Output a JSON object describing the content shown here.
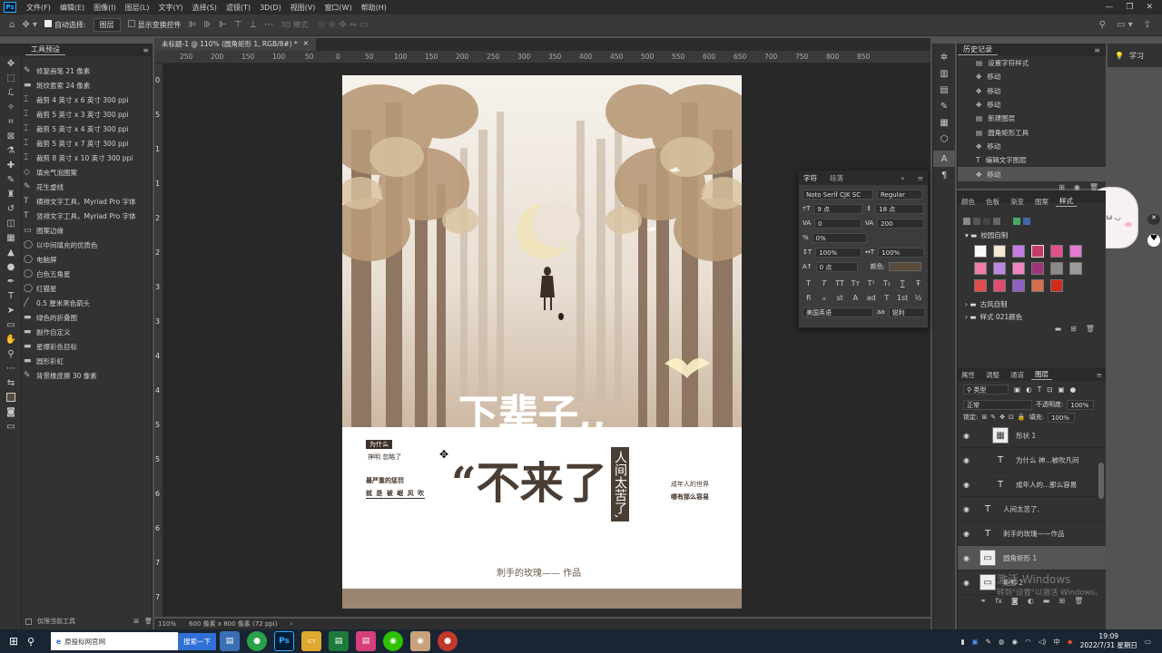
{
  "app": {
    "logo": "Ps"
  },
  "menu": [
    "文件(F)",
    "编辑(E)",
    "图像(I)",
    "图层(L)",
    "文字(Y)",
    "选择(S)",
    "滤镜(T)",
    "3D(D)",
    "视图(V)",
    "窗口(W)",
    "帮助(H)"
  ],
  "options": {
    "auto_select_label": "自动选择:",
    "auto_select_value": "图层",
    "show_transform_label": "显示变换控件",
    "mode3d_label": "3D 模式:"
  },
  "doc_tab": {
    "title": "未标题-1 @ 110% (圆角矩形 1, RGB/8#) *",
    "close": "×"
  },
  "ruler_h": [
    "250",
    "200",
    "150",
    "100",
    "50",
    "0",
    "50",
    "100",
    "150",
    "200",
    "250",
    "300",
    "350",
    "400",
    "450",
    "500",
    "550",
    "600",
    "650",
    "700",
    "750",
    "800",
    "850"
  ],
  "ruler_v": [
    "0",
    "5",
    "1",
    "1",
    "2",
    "2",
    "3",
    "3",
    "4",
    "4",
    "5",
    "5",
    "6",
    "6",
    "7",
    "7"
  ],
  "tool_presets_tab": "工具预设",
  "tool_presets": [
    {
      "icon": "✎",
      "label": "修复画笔 21 像素"
    },
    {
      "icon": "▬",
      "label": "斑纹套索 24 像素"
    },
    {
      "icon": "⌶",
      "label": "裁剪 4 英寸 x 6 英寸 300 ppi"
    },
    {
      "icon": "⌶",
      "label": "裁剪 5 英寸 x 3 英寸 300 ppi"
    },
    {
      "icon": "⌶",
      "label": "裁剪 5 英寸 x 4 英寸 300 ppi"
    },
    {
      "icon": "⌶",
      "label": "裁剪 5 英寸 x 7 英寸 300 ppi"
    },
    {
      "icon": "⌶",
      "label": "裁剪 8 英寸 x 10 英寸 300 ppi"
    },
    {
      "icon": "◇",
      "label": "填充气泡图案"
    },
    {
      "icon": "✎",
      "label": "花生虚线"
    },
    {
      "icon": "T",
      "label": "横排文字工具，Myriad Pro 字体"
    },
    {
      "icon": "T",
      "label": "竖排文字工具，Myriad Pro 字体"
    },
    {
      "icon": "▭",
      "label": "图案边缘"
    },
    {
      "icon": "◯",
      "label": "以中间填充的优质色"
    },
    {
      "icon": "◯",
      "label": "电脑屏"
    },
    {
      "icon": "◯",
      "label": "白色五角星"
    },
    {
      "icon": "◯",
      "label": "红猫星"
    },
    {
      "icon": "╱",
      "label": "0.5 厘米黑色箭头"
    },
    {
      "icon": "▬",
      "label": "绿色的折叠图"
    },
    {
      "icon": "▬",
      "label": "副作自定义"
    },
    {
      "icon": "▬",
      "label": "星爆彩色目标"
    },
    {
      "icon": "▬",
      "label": "圆形彩虹"
    },
    {
      "icon": "✎",
      "label": "背景橡皮擦 30 像素"
    }
  ],
  "tool_footer": "仅限当前工具",
  "status": {
    "zoom": "110%",
    "doc_size": "600 像素 x 800 像素 (72 ppi)"
  },
  "poster": {
    "tag": "为什么",
    "line1": "神明 忽略了",
    "line2": "最严重的惩罚",
    "line3": "就 是 被 岷 风 吹",
    "title1": "下辈子,,",
    "title2": "“不来了",
    "vertical": "人间太苦了,",
    "right1": "成年人的世界",
    "right2": "哪有那么容易",
    "credit": "刺手的玫瑰—— 作品"
  },
  "history": {
    "tab": "历史记录",
    "items": [
      {
        "icon": "▤",
        "label": "设置字符样式"
      },
      {
        "icon": "✥",
        "label": "移动"
      },
      {
        "icon": "✥",
        "label": "移动"
      },
      {
        "icon": "✥",
        "label": "移动"
      },
      {
        "icon": "▤",
        "label": "新建图层"
      },
      {
        "icon": "▤",
        "label": "圆角矩形工具"
      },
      {
        "icon": "✥",
        "label": "移动"
      },
      {
        "icon": "T",
        "label": "编辑文字图层"
      },
      {
        "icon": "✥",
        "label": "移动"
      }
    ]
  },
  "learn": {
    "label": "学习"
  },
  "character": {
    "tabs": [
      "字符",
      "段落"
    ],
    "font": "Noto Serif CJK SC",
    "style": "Regular",
    "size": "9 点",
    "leading": "18 点",
    "kerning": "0",
    "tracking": "200",
    "tsume": "0%",
    "vscale": "100%",
    "hscale": "100%",
    "baseline": "0 点",
    "color_label": "颜色:",
    "lang": "美国英语",
    "aa": "锐利",
    "aa_prefix": "aa",
    "style_buttons": [
      "T",
      "T",
      "TT",
      "Tт",
      "T¹",
      "T₁",
      "T",
      "Ŧ"
    ],
    "ot_buttons": [
      "fi",
      "ℴ",
      "st",
      "A",
      "ad",
      "T",
      "1st",
      "½"
    ]
  },
  "swatches": {
    "tabs": [
      "颜色",
      "色板",
      "渐变",
      "图案",
      "样式"
    ],
    "group1": "校园自制",
    "group2": "古风自制",
    "group3": "样式 021颜色",
    "colors": [
      "#f8f8f8",
      "#f3e9d2",
      "#c47adf",
      "#c43b6b",
      "#e24f8c",
      "#e37ad1",
      "#f07ca8",
      "#b78ae0",
      "#ef85c0",
      "#a0337a",
      "#8a8a8a",
      "#9a9a9a",
      "#e24c4c",
      "#e24c6e",
      "#8e62c5",
      "#d86f4a",
      "#d02a1a"
    ]
  },
  "layers": {
    "tabs": [
      "属性",
      "调整",
      "通道",
      "图层"
    ],
    "kind": "类型",
    "blend": "正常",
    "opacity_label": "不透明度:",
    "opacity": "100%",
    "lock_label": "锁定:",
    "fill_label": "填充:",
    "fill": "100%",
    "items": [
      {
        "type": "img",
        "name": "形状 1",
        "selected": false
      },
      {
        "type": "text",
        "name": "为什么 神...被吹凡间",
        "selected": false
      },
      {
        "type": "text",
        "name": "成年人的...那么容易",
        "selected": false
      },
      {
        "type": "text",
        "name": "人间太苦了,",
        "selected": false
      },
      {
        "type": "text",
        "name": "刺手的玫瑰——作品",
        "selected": false
      },
      {
        "type": "img",
        "name": "圆角矩形 1",
        "selected": true
      },
      {
        "type": "img",
        "name": "矩形 2",
        "selected": false
      }
    ]
  },
  "watermark": {
    "line1": "激活 Windows",
    "line2": "转到\"设置\"以激活 Windows。"
  },
  "taskbar": {
    "search": "原投标网官网",
    "search_btn": "搜索一下",
    "apps": [
      "▤",
      "●",
      "Ps",
      "▭",
      "▤",
      "▤",
      "◉",
      "◉",
      "●"
    ],
    "time": "19:09",
    "date": "2022/7/31 星期日"
  },
  "colors": {
    "ps_blue": "#31a8ff",
    "canvas": "#282828",
    "panel": "#323232",
    "poster_bar": "#9b8672"
  }
}
